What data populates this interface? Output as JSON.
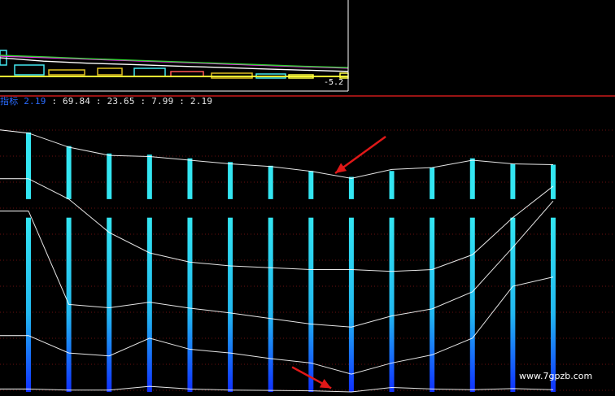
{
  "readout": {
    "label": "指标 2.19",
    "values_text": " : 69.84 : 23.65 : 7.99 : 2.19"
  },
  "top_panel": {
    "value_label": "-5.2"
  },
  "watermark": "www.7gpzb.com",
  "colors": {
    "background": "#000000",
    "bar_top": "#33e6f2",
    "bar_bottom": "#1030ff",
    "line": "#ffffff",
    "separator": "#cc1a1a",
    "grid": "#6a1010",
    "arrow": "#e01818",
    "magenta": "#ff33ff",
    "green": "#33cc33"
  },
  "chart_data": [
    {
      "type": "line",
      "panel": "indicator",
      "x": [
        0,
        1,
        2,
        3,
        4,
        5,
        6,
        7,
        8,
        9,
        10,
        11,
        12,
        13
      ],
      "series": [
        {
          "values": [
            69.8,
            66.0,
            63.8,
            63.5,
            62.5,
            61.5,
            60.8,
            59.5,
            57.6,
            60.0,
            60.5,
            62.5,
            61.5,
            61.3
          ]
        },
        {
          "values": [
            57.5,
            52.0,
            43.0,
            37.5,
            35.0,
            34.0,
            33.5,
            33.0,
            33.0,
            32.5,
            33.0,
            37.0,
            47.0,
            55.5
          ]
        },
        {
          "values": [
            48.8,
            23.6,
            22.7,
            24.2,
            22.6,
            21.3,
            19.8,
            18.3,
            17.5,
            20.5,
            22.4,
            27.0,
            39.0,
            51.5
          ]
        },
        {
          "values": [
            15.2,
            10.5,
            9.7,
            14.5,
            11.5,
            10.5,
            9.0,
            7.8,
            4.8,
            7.8,
            10.0,
            14.5,
            28.5,
            31.0
          ]
        },
        {
          "values": [
            0.8,
            0.5,
            0.5,
            1.5,
            0.8,
            0.5,
            0.4,
            0.3,
            0.0,
            1.2,
            0.8,
            0.6,
            0.9,
            0.6
          ]
        }
      ],
      "bars": {
        "upper_segment_top": [
          70.0,
          66.3,
          64.3,
          64.0,
          63.0,
          62.0,
          61.0,
          59.6,
          58.0,
          59.6,
          60.5,
          63.0,
          61.5,
          61.3
        ],
        "upper_segment_bottom": [
          52.0,
          52.0,
          52.0,
          52.0,
          52.0,
          52.0,
          52.0,
          52.0,
          52.0,
          52.0,
          52.0,
          52.0,
          52.0,
          52.0
        ],
        "lower_segment_top": [
          47.0,
          47.0,
          47.0,
          47.0,
          47.0,
          47.0,
          47.0,
          47.0,
          47.0,
          47.0,
          47.0,
          47.0,
          47.0,
          47.0
        ],
        "lower_segment_bottom": [
          0.0,
          0.0,
          0.0,
          0.0,
          0.0,
          0.0,
          0.0,
          0.0,
          0.0,
          0.0,
          0.0,
          0.0,
          0.0,
          0.0
        ]
      },
      "ylim": [
        0,
        75
      ],
      "grid": true,
      "annotations": [
        {
          "type": "arrow",
          "target_x": 7.6,
          "target_y": 59.0,
          "direction": "down-left"
        },
        {
          "type": "arrow",
          "target_x": 7.5,
          "target_y": 1.0,
          "direction": "down-right"
        }
      ]
    },
    {
      "type": "line",
      "panel": "top-partial",
      "x": [
        0,
        1,
        2,
        3,
        4,
        5,
        6,
        7,
        8
      ],
      "series": [
        {
          "values": [
            8.5,
            7.2,
            6.4,
            5.9,
            5.3,
            4.8,
            4.2,
            3.7,
            3.2
          ]
        },
        {
          "values": [
            9.2,
            8.6,
            8.0,
            7.4,
            6.8,
            6.2,
            5.6,
            5.0,
            4.5
          ]
        },
        {
          "values": [
            9.5,
            8.9,
            8.2,
            7.6,
            7.0,
            6.4,
            5.8,
            5.2,
            4.7
          ]
        }
      ],
      "ylim": [
        0,
        12
      ]
    }
  ]
}
